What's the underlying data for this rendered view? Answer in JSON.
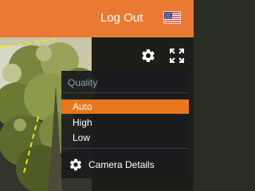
{
  "header": {
    "logout_label": "Log Out",
    "language_flag_icon": "us-flag-icon"
  },
  "player": {
    "settings_icon": "gear-icon",
    "fullscreen_icon": "fullscreen-icon"
  },
  "settings_menu": {
    "header": "Quality",
    "options": [
      {
        "label": "Auto",
        "selected": true
      },
      {
        "label": "High",
        "selected": false
      },
      {
        "label": "Low",
        "selected": false
      }
    ],
    "camera_details": {
      "label": "Camera Details",
      "icon": "gear-icon"
    }
  },
  "colors": {
    "accent": "#ea7a33",
    "selected_option": "#e8761c",
    "menu_background": "#191b1d",
    "menu_header": "#8c9bb6"
  }
}
